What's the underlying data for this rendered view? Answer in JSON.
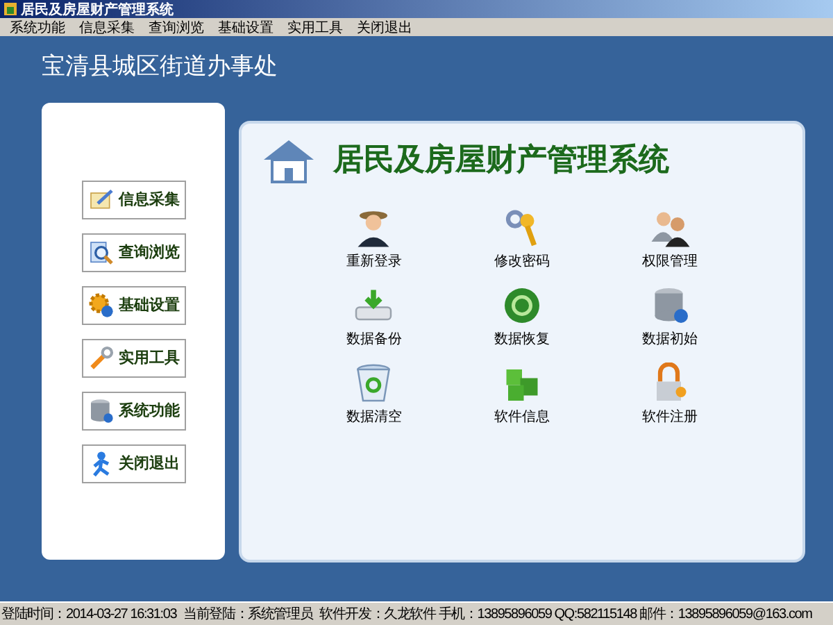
{
  "window": {
    "title": "居民及房屋财产管理系统"
  },
  "menu": [
    "系统功能",
    "信息采集",
    "查询浏览",
    "基础设置",
    "实用工具",
    "关闭退出"
  ],
  "org_name": "宝清县城区街道办事处",
  "sidebar": {
    "items": [
      {
        "label": "信息采集",
        "kind": "notepad"
      },
      {
        "label": "查询浏览",
        "kind": "search"
      },
      {
        "label": "基础设置",
        "kind": "gear"
      },
      {
        "label": "实用工具",
        "kind": "wrench"
      },
      {
        "label": "系统功能",
        "kind": "database"
      },
      {
        "label": "关闭退出",
        "kind": "person"
      }
    ]
  },
  "main": {
    "title": "居民及房屋财产管理系统",
    "functions": [
      {
        "label": "重新登录",
        "kind": "user"
      },
      {
        "label": "修改密码",
        "kind": "key"
      },
      {
        "label": "权限管理",
        "kind": "users"
      },
      {
        "label": "数据备份",
        "kind": "drive"
      },
      {
        "label": "数据恢复",
        "kind": "restore"
      },
      {
        "label": "数据初始",
        "kind": "database"
      },
      {
        "label": "数据清空",
        "kind": "trash"
      },
      {
        "label": "软件信息",
        "kind": "cubes"
      },
      {
        "label": "软件注册",
        "kind": "lock"
      }
    ]
  },
  "status_bar": [
    {
      "label": "登陆时间：",
      "value": "2014-03-27 16:31:03"
    },
    {
      "label": "当前登陆：",
      "value": "系统管理员"
    },
    {
      "label": "软件开发：",
      "value": "久龙软件"
    },
    {
      "label": "手机：",
      "value": "13895896059"
    },
    {
      "label": "QQ:",
      "value": "582115148"
    },
    {
      "label": "邮件：",
      "value": "13895896059@163.com"
    }
  ]
}
